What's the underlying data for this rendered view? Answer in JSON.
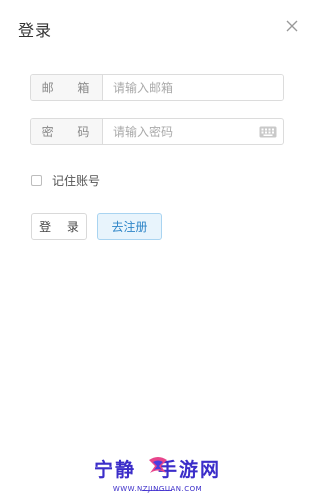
{
  "dialog": {
    "title": "登录"
  },
  "email": {
    "label": "邮 箱",
    "placeholder": "请输入邮箱",
    "value": ""
  },
  "password": {
    "label": "密 码",
    "placeholder": "请输入密码",
    "value": ""
  },
  "remember": {
    "label": "记住账号",
    "checked": false
  },
  "actions": {
    "login_label": "登 录",
    "register_label": "去注册"
  },
  "watermark": {
    "brand_left": "宁静",
    "brand_right": "手游网",
    "url": "WWW.NZJINGUAN.COM"
  },
  "colors": {
    "accent": "#2f86c8",
    "accent_bg": "#e8f4fc",
    "border": "#dcdcdc",
    "watermark": "#3b2dc9"
  },
  "icons": {
    "close": "close-icon",
    "keyboard": "keyboard-icon"
  }
}
